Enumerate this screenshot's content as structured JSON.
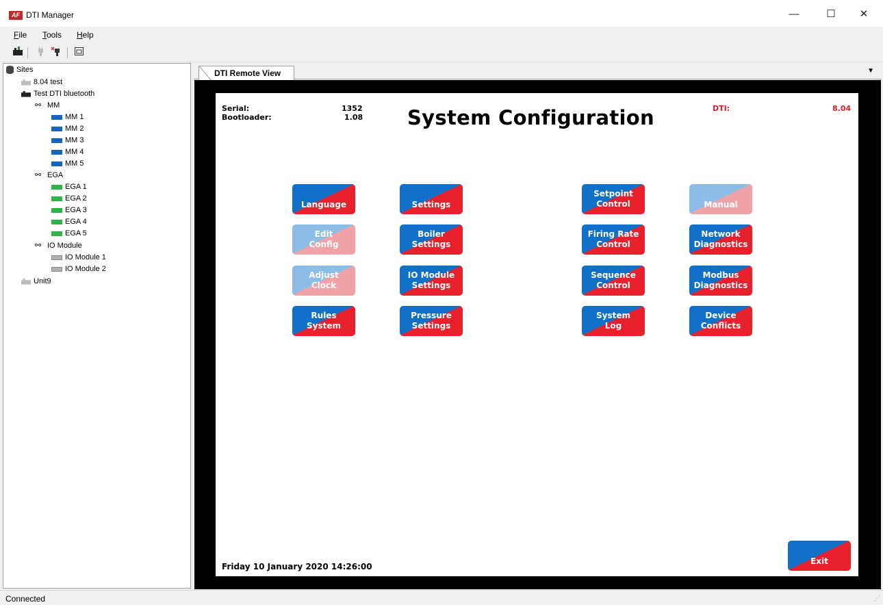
{
  "window": {
    "logo": "AF",
    "title": "DTI Manager",
    "minimize": "—",
    "maximize": "☐",
    "close": "✕"
  },
  "menu": {
    "file": "ile",
    "file_key": "F",
    "tools": "ools",
    "tools_key": "T",
    "help": "elp",
    "help_key": "H"
  },
  "tree": {
    "root": "Sites",
    "items": [
      {
        "label": "8.04 test"
      },
      {
        "label": "Test DTI bluetooth"
      },
      {
        "label": "MM"
      },
      {
        "label": "MM 1"
      },
      {
        "label": "MM 2"
      },
      {
        "label": "MM 3"
      },
      {
        "label": "MM 4"
      },
      {
        "label": "MM 5"
      },
      {
        "label": "EGA"
      },
      {
        "label": "EGA 1"
      },
      {
        "label": "EGA 2"
      },
      {
        "label": "EGA 3"
      },
      {
        "label": "EGA 4"
      },
      {
        "label": "EGA 5"
      },
      {
        "label": "IO Module"
      },
      {
        "label": "IO Module 1"
      },
      {
        "label": "IO Module 2"
      },
      {
        "label": "Unit9"
      }
    ]
  },
  "tab": {
    "label": "DTI Remote View"
  },
  "screen": {
    "serial_label": "Serial:",
    "serial_value": "1352",
    "bootloader_label": "Bootloader:",
    "bootloader_value": "1.08",
    "dti_label": "DTI:",
    "dti_value": "8.04",
    "title": "System Configuration",
    "datetime": "Friday 10 January 2020 14:26:00",
    "buttons": {
      "language": [
        "",
        "Language"
      ],
      "settings": [
        "",
        "Settings"
      ],
      "setpoint": [
        "Setpoint",
        "Control"
      ],
      "manual": [
        "",
        "Manual"
      ],
      "edit_config": [
        "Edit",
        "Config"
      ],
      "boiler": [
        "Boiler",
        "Settings"
      ],
      "firing": [
        "Firing Rate",
        "Control"
      ],
      "network": [
        "Network",
        "Diagnostics"
      ],
      "adjust_clock": [
        "Adjust",
        "Clock"
      ],
      "io_module": [
        "IO Module",
        "Settings"
      ],
      "sequence": [
        "Sequence",
        "Control"
      ],
      "modbus": [
        "Modbus",
        "Diagnostics"
      ],
      "rules": [
        "Rules",
        "System"
      ],
      "pressure": [
        "Pressure",
        "Settings"
      ],
      "system_log": [
        "System",
        "Log"
      ],
      "device_conflicts": [
        "Device",
        "Conflicts"
      ],
      "exit": [
        "",
        "Exit"
      ]
    }
  },
  "status": {
    "text": "Connected"
  },
  "colors": {
    "button_blue": "#1070c8",
    "button_red": "#e8202c",
    "mm": "#1565c0",
    "ega": "#2db34a",
    "io": "#b0b0b0"
  }
}
